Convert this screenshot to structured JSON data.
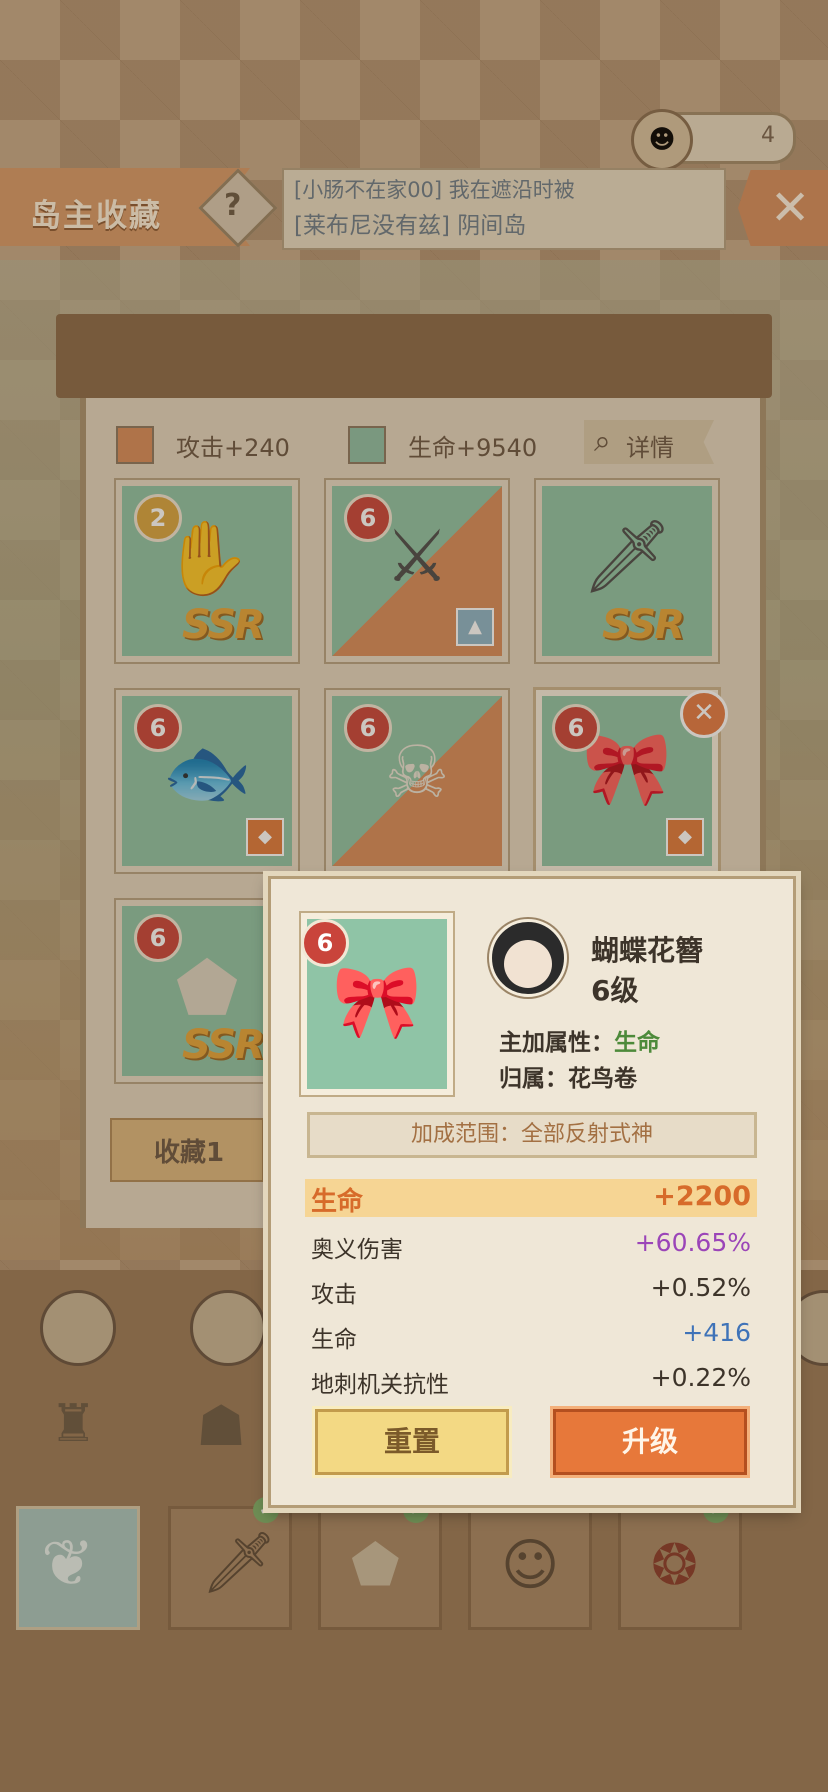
{
  "header": {
    "counter": "4",
    "title": "岛主收藏",
    "help": "?",
    "notice_line1": "[小肠不在家00] 我在遮沿时被",
    "notice_line2": "[莱布尼没有兹] 阴间岛",
    "close": "✕"
  },
  "stats": {
    "attack": "攻击+240",
    "hp": "生命+9540",
    "detail": "详情"
  },
  "cards": [
    {
      "level": "2",
      "ssr": "SSR",
      "icon": "hand-mirror-icon"
    },
    {
      "level": "6",
      "icon": "katana-icon"
    },
    {
      "level": "",
      "ssr": "SSR",
      "icon": "dagger-icon"
    },
    {
      "level": "6",
      "icon": "fish-icon"
    },
    {
      "level": "6",
      "icon": "ghost-skull-icon"
    },
    {
      "level": "6",
      "icon": "butterfly-hairpin-icon"
    },
    {
      "level": "6",
      "ssr": "SSR",
      "icon": "stone-icon"
    }
  ],
  "tab": {
    "label": "收藏1"
  },
  "colors": {
    "attack": "#d88c5a",
    "hp": "#8fc4a6",
    "upgrade": "#e7783a"
  },
  "popup": {
    "level": "6",
    "name": "蝴蝶花簪",
    "level_text": "6级",
    "main_attr_label": "主加属性：",
    "main_attr_value": "生命",
    "belong_label": "归属：",
    "belong_value": "花鸟卷",
    "range": "加成范围：全部反射式神",
    "rows": [
      {
        "k": "生命",
        "v": "+2200"
      },
      {
        "k": "奥义伤害",
        "v": "+60.65%"
      },
      {
        "k": "攻击",
        "v": "+0.52%"
      },
      {
        "k": "生命",
        "v": "+416"
      },
      {
        "k": "地刺机关抗性",
        "v": "+0.22%"
      }
    ],
    "reset": "重置",
    "upgrade": "升级"
  }
}
